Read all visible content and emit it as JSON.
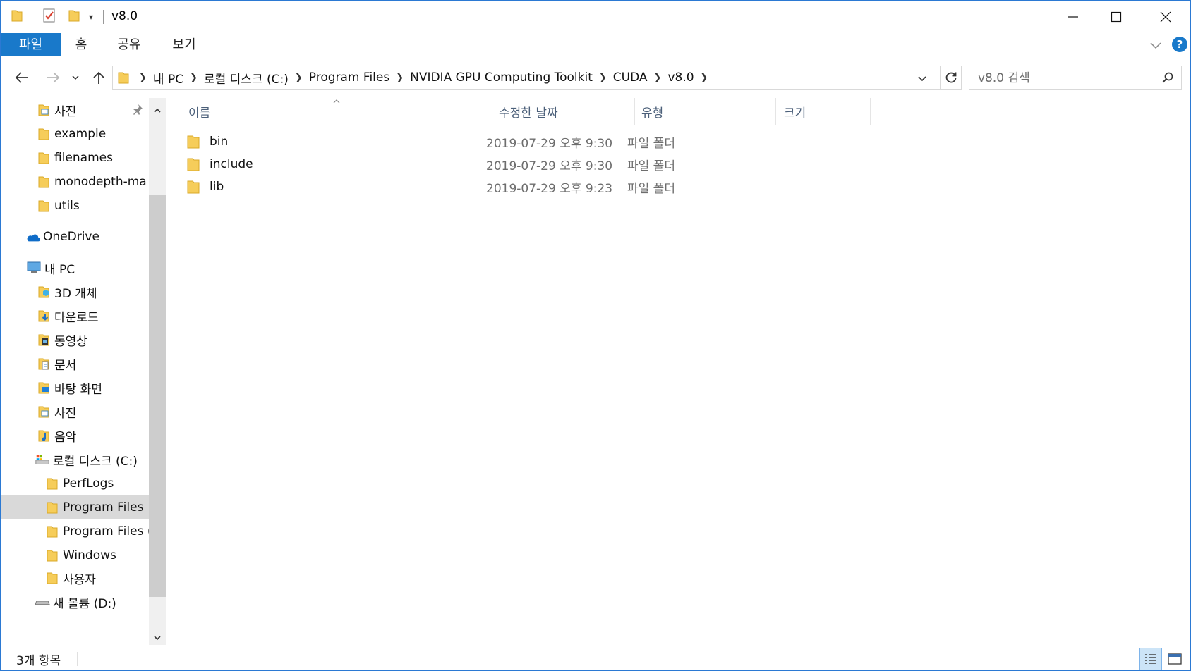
{
  "window": {
    "title": "v8.0",
    "accent_color": "#1979ca"
  },
  "ribbon": {
    "tabs": [
      {
        "label": "파일",
        "active": true
      },
      {
        "label": "홈"
      },
      {
        "label": "공유"
      },
      {
        "label": "보기"
      }
    ]
  },
  "address": {
    "crumbs": [
      "내 PC",
      "로컬 디스크 (C:)",
      "Program Files",
      "NVIDIA GPU Computing Toolkit",
      "CUDA",
      "v8.0"
    ]
  },
  "search": {
    "placeholder": "v8.0 검색"
  },
  "navpane": {
    "items": [
      {
        "label": "사진",
        "icon": "pictures-folder-icon",
        "pinned": true
      },
      {
        "label": "example",
        "icon": "folder-icon"
      },
      {
        "label": "filenames",
        "icon": "folder-icon"
      },
      {
        "label": "monodepth-ma",
        "icon": "folder-icon"
      },
      {
        "label": "utils",
        "icon": "folder-icon"
      },
      {
        "label": "OneDrive",
        "icon": "onedrive-cloud-icon"
      },
      {
        "label": "내 PC",
        "icon": "this-pc-icon"
      },
      {
        "label": "3D 개체",
        "icon": "3d-objects-icon"
      },
      {
        "label": "다운로드",
        "icon": "downloads-icon"
      },
      {
        "label": "동영상",
        "icon": "videos-icon"
      },
      {
        "label": "문서",
        "icon": "documents-icon"
      },
      {
        "label": "바탕 화면",
        "icon": "desktop-icon"
      },
      {
        "label": "사진",
        "icon": "pictures-folder-icon"
      },
      {
        "label": "음악",
        "icon": "music-icon"
      },
      {
        "label": "로컬 디스크 (C:)",
        "icon": "local-disk-icon"
      },
      {
        "label": "PerfLogs",
        "icon": "folder-icon"
      },
      {
        "label": "Program Files",
        "icon": "folder-icon",
        "selected": true
      },
      {
        "label": "Program Files (",
        "icon": "folder-icon"
      },
      {
        "label": "Windows",
        "icon": "folder-icon"
      },
      {
        "label": "사용자",
        "icon": "folder-icon"
      },
      {
        "label": "새 볼륨 (D:)",
        "icon": "drive-icon"
      }
    ]
  },
  "columns": {
    "name": "이름",
    "date": "수정한 날짜",
    "type": "유형",
    "size": "크기"
  },
  "files": [
    {
      "name": "bin",
      "date": "2019-07-29 오후 9:30",
      "type": "파일 폴더"
    },
    {
      "name": "include",
      "date": "2019-07-29 오후 9:30",
      "type": "파일 폴더"
    },
    {
      "name": "lib",
      "date": "2019-07-29 오후 9:23",
      "type": "파일 폴더"
    }
  ],
  "status": {
    "count": "3개 항목"
  }
}
